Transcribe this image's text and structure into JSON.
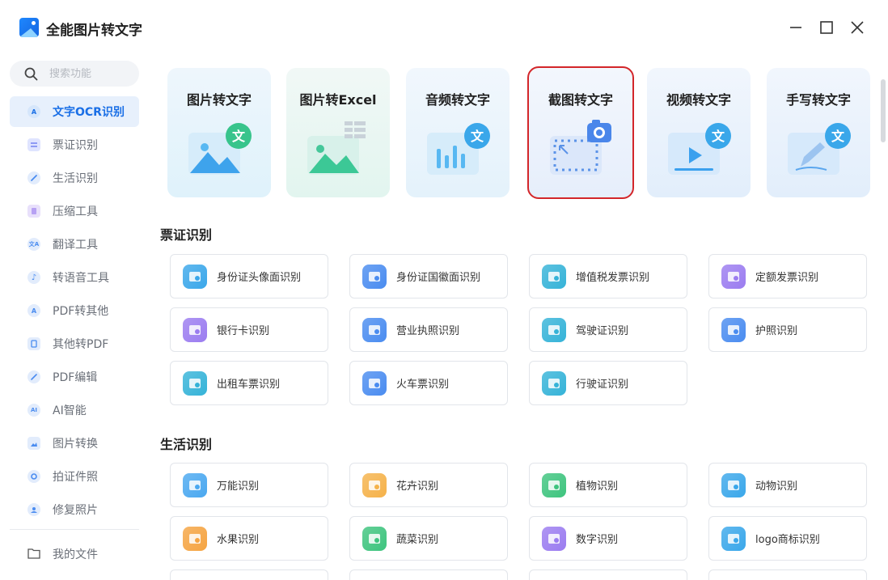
{
  "window": {
    "title": "全能图片转文字"
  },
  "sidebar": {
    "search_placeholder": "搜索功能",
    "items": [
      {
        "label": "文字OCR识别",
        "icon": "ocr-icon",
        "active": true
      },
      {
        "label": "票证识别",
        "icon": "ticket-icon"
      },
      {
        "label": "生活识别",
        "icon": "pen-icon"
      },
      {
        "label": "压缩工具",
        "icon": "compress-icon"
      },
      {
        "label": "翻译工具",
        "icon": "translate-icon"
      },
      {
        "label": "转语音工具",
        "icon": "music-note-icon"
      },
      {
        "label": "PDF转其他",
        "icon": "pdf-export-icon"
      },
      {
        "label": "其他转PDF",
        "icon": "pdf-import-icon"
      },
      {
        "label": "PDF编辑",
        "icon": "pdf-edit-icon"
      },
      {
        "label": "AI智能",
        "icon": "ai-icon"
      },
      {
        "label": "图片转换",
        "icon": "image-convert-icon"
      },
      {
        "label": "拍证件照",
        "icon": "camera-icon"
      },
      {
        "label": "修复照片",
        "icon": "repair-photo-icon"
      }
    ],
    "my_files": "我的文件"
  },
  "top_cards": [
    {
      "title": "图片转文字"
    },
    {
      "title": "图片转Excel"
    },
    {
      "title": "音频转文字"
    },
    {
      "title": "截图转文字",
      "selected": true
    },
    {
      "title": "视频转文字"
    },
    {
      "title": "手写转文字"
    }
  ],
  "badge_glyph": "文",
  "sections": {
    "tickets": {
      "title": "票证识别",
      "items": [
        {
          "label": "身份证头像面识别",
          "color": "#3aa7ea"
        },
        {
          "label": "身份证国徽面识别",
          "color": "#4a8cf0"
        },
        {
          "label": "增值税发票识别",
          "color": "#35b3d8"
        },
        {
          "label": "定额发票识别",
          "color": "#9b7cf0"
        },
        {
          "label": "银行卡识别",
          "color": "#9b7cf0"
        },
        {
          "label": "营业执照识别",
          "color": "#4a8cf0"
        },
        {
          "label": "驾驶证识别",
          "color": "#35b3d8"
        },
        {
          "label": "护照识别",
          "color": "#4a8cf0"
        },
        {
          "label": "出租车票识别",
          "color": "#35b3d8"
        },
        {
          "label": "火车票识别",
          "color": "#4a8cf0"
        },
        {
          "label": "行驶证识别",
          "color": "#35b3d8"
        }
      ]
    },
    "life": {
      "title": "生活识别",
      "items": [
        {
          "label": "万能识别",
          "color": "#4aa8f0"
        },
        {
          "label": "花卉识别",
          "color": "#f5b24a"
        },
        {
          "label": "植物识别",
          "color": "#3ec47e"
        },
        {
          "label": "动物识别",
          "color": "#3aa7ea"
        },
        {
          "label": "水果识别",
          "color": "#f5a442"
        },
        {
          "label": "蔬菜识别",
          "color": "#3ec47e"
        },
        {
          "label": "数字识别",
          "color": "#9b7cf0"
        },
        {
          "label": "logo商标识别",
          "color": "#3aa7ea"
        }
      ]
    }
  }
}
